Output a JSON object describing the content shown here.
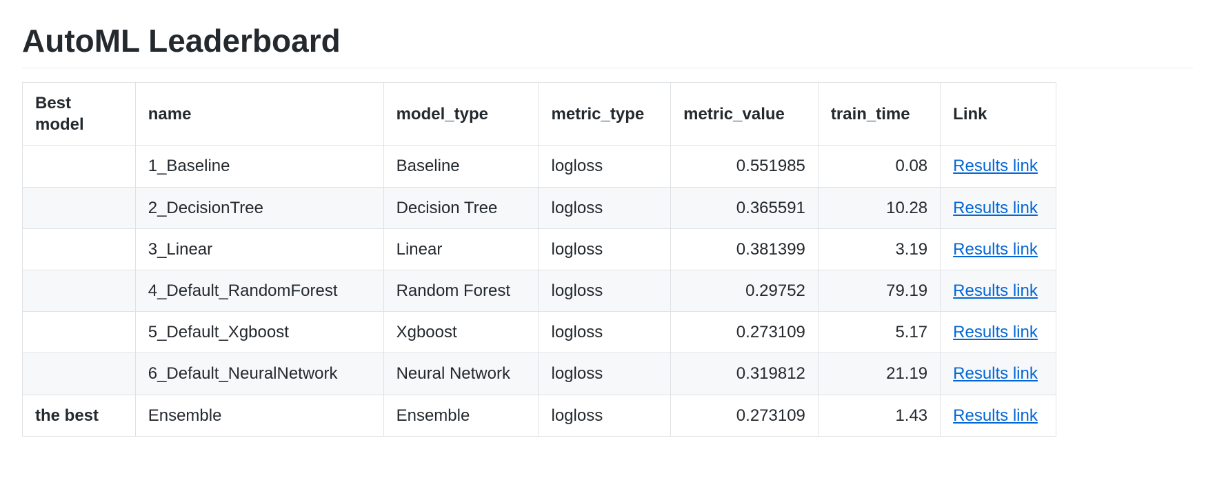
{
  "title": "AutoML Leaderboard",
  "columns": {
    "best": "Best model",
    "name": "name",
    "model_type": "model_type",
    "metric_type": "metric_type",
    "metric_value": "metric_value",
    "train_time": "train_time",
    "link": "Link"
  },
  "link_label": "Results link",
  "rows": [
    {
      "best": "",
      "name": "1_Baseline",
      "model_type": "Baseline",
      "metric_type": "logloss",
      "metric_value": "0.551985",
      "train_time": "0.08"
    },
    {
      "best": "",
      "name": "2_DecisionTree",
      "model_type": "Decision Tree",
      "metric_type": "logloss",
      "metric_value": "0.365591",
      "train_time": "10.28"
    },
    {
      "best": "",
      "name": "3_Linear",
      "model_type": "Linear",
      "metric_type": "logloss",
      "metric_value": "0.381399",
      "train_time": "3.19"
    },
    {
      "best": "",
      "name": "4_Default_RandomForest",
      "model_type": "Random Forest",
      "metric_type": "logloss",
      "metric_value": "0.29752",
      "train_time": "79.19"
    },
    {
      "best": "",
      "name": "5_Default_Xgboost",
      "model_type": "Xgboost",
      "metric_type": "logloss",
      "metric_value": "0.273109",
      "train_time": "5.17"
    },
    {
      "best": "",
      "name": "6_Default_NeuralNetwork",
      "model_type": "Neural Network",
      "metric_type": "logloss",
      "metric_value": "0.319812",
      "train_time": "21.19"
    },
    {
      "best": "the best",
      "name": "Ensemble",
      "model_type": "Ensemble",
      "metric_type": "logloss",
      "metric_value": "0.273109",
      "train_time": "1.43"
    }
  ]
}
